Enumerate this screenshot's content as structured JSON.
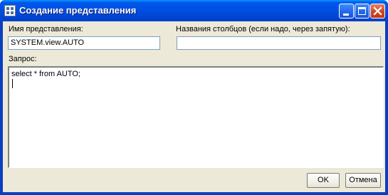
{
  "window": {
    "title": "Создание представления",
    "buttons": {
      "minimize": "minimize-icon",
      "maximize": "maximize-icon",
      "close": "close-icon"
    }
  },
  "form": {
    "view_name_label": "Имя представления:",
    "view_name_value": "SYSTEM.view.AUTO",
    "columns_label": "Названия столбцов (если надо, через запятую):",
    "columns_value": "",
    "query_label": "Запрос:",
    "query_value": "select * from AUTO;"
  },
  "actions": {
    "ok_label": "OK",
    "cancel_label": "Отмена"
  },
  "colors": {
    "titlebar": "#0054e3",
    "close_button": "#d2461f",
    "dialog_background": "#ece9d8",
    "input_border": "#7f9db9"
  }
}
